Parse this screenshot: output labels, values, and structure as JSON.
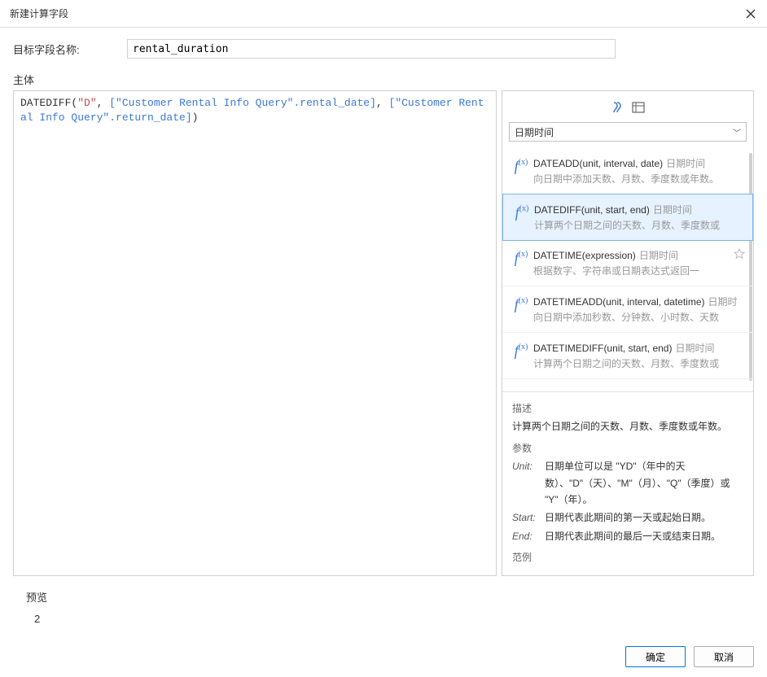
{
  "dialog": {
    "title": "新建计算字段"
  },
  "field": {
    "label": "目标字段名称:",
    "value": "rental_duration"
  },
  "body": {
    "label": "主体",
    "expr_fn": "DATEDIFF",
    "expr_str": "\"D\"",
    "expr_ref1": "[\"Customer Rental Info Query\".rental_date]",
    "expr_ref2": "[\"Customer Rental Info Query\".return_date]"
  },
  "side": {
    "category": "日期时间",
    "functions": [
      {
        "sig": "DATEADD(unit, interval, date)",
        "cat": "日期时间",
        "desc": "向日期中添加天数、月数、季度数或年数。",
        "selected": false,
        "star": false
      },
      {
        "sig": "DATEDIFF(unit, start, end)",
        "cat": "日期时间",
        "desc": "计算两个日期之间的天数、月数、季度数或",
        "selected": true,
        "star": false
      },
      {
        "sig": "DATETIME(expression)",
        "cat": "日期时间",
        "desc": "根据数字、字符串或日期表达式返回一",
        "selected": false,
        "star": true
      },
      {
        "sig": "DATETIMEADD(unit, interval, datetime)",
        "cat": "日期时",
        "desc": "向日期中添加秒数、分钟数、小时数、天数",
        "selected": false,
        "star": false
      },
      {
        "sig": "DATETIMEDIFF(unit, start, end)",
        "cat": "日期时间",
        "desc": "计算两个日期之间的天数、月数、季度数或",
        "selected": false,
        "star": false
      }
    ]
  },
  "desc": {
    "heading_desc": "描述",
    "text_desc": "计算两个日期之间的天数、月数、季度数或年数。",
    "heading_params": "参数",
    "params": [
      {
        "name": "Unit:",
        "text": "日期单位可以是 \"YD\"（年中的天数）、\"D\"（天）、\"M\"（月）、\"Q\"（季度）或 \"Y\"（年）。"
      },
      {
        "name": "Start:",
        "text": "日期代表此期间的第一天或起始日期。"
      },
      {
        "name": "End:",
        "text": "日期代表此期间的最后一天或结束日期。"
      }
    ],
    "heading_example": "范例"
  },
  "preview": {
    "label": "预览",
    "value": "2"
  },
  "buttons": {
    "ok": "确定",
    "cancel": "取消"
  }
}
